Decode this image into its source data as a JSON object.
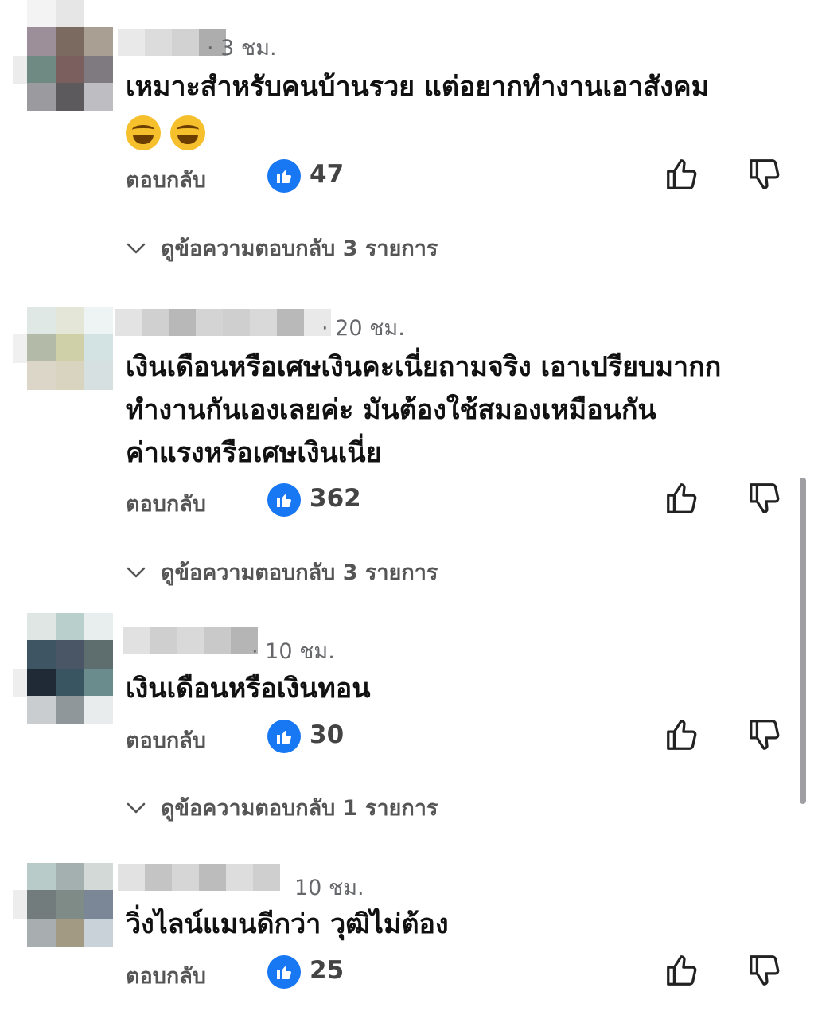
{
  "comments": [
    {
      "time": "· 3 ชม.",
      "text_lines": [
        "เหมาะสำหรับคนบ้านรวย แต่อยากทำงานเอาสังคม"
      ],
      "emojis": [
        "rolling-on-floor-laughing-emoji",
        "rolling-on-floor-laughing-emoji"
      ],
      "reply_label": "ตอบกลับ",
      "likes": "47",
      "view_replies": "ดูข้อความตอบกลับ 3 รายการ"
    },
    {
      "time": "· 20 ชม.",
      "text_lines": [
        "เงินเดือนหรือเศษเงินคะเนี่ยถามจริง เอาเปรียบมากก",
        "ทำงานกันเองเลยค่ะ มันต้องใช้สมองเหมือนกัน",
        "ค่าแรงหรือเศษเงินเนี่ย"
      ],
      "reply_label": "ตอบกลับ",
      "likes": "362",
      "view_replies": "ดูข้อความตอบกลับ 3 รายการ"
    },
    {
      "time": "· 10 ชม.",
      "text_lines": [
        "เงินเดือนหรือเงินทอน"
      ],
      "reply_label": "ตอบกลับ",
      "likes": "30",
      "view_replies": "ดูข้อความตอบกลับ 1 รายการ"
    },
    {
      "time": "10 ชม.",
      "text_lines": [
        "วิ่งไลน์แมนดีกว่า วุฒิไม่ต้อง"
      ],
      "reply_label": "ตอบกลับ",
      "likes": "25"
    }
  ],
  "colors": {
    "like_blue": "#1877f2",
    "meta_gray": "#65676b",
    "text": "#111111"
  },
  "icons": {
    "like_badge": "thumbs-up-icon",
    "like": "thumbs-up-outline-icon",
    "dislike": "thumbs-down-outline-icon",
    "expand": "chevron-down-icon"
  }
}
